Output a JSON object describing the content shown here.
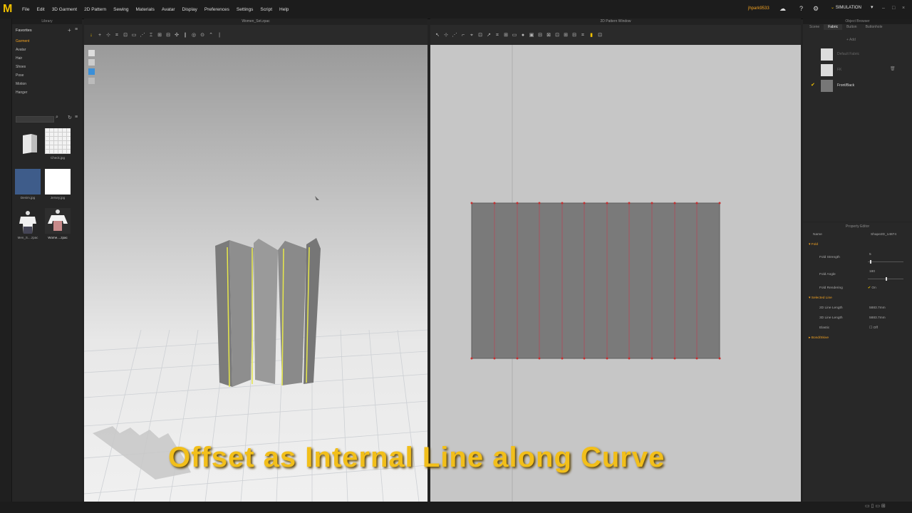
{
  "menubar": {
    "logo": "M",
    "items": [
      "File",
      "Edit",
      "3D Garment",
      "2D Pattern",
      "Sewing",
      "Materials",
      "Avatar",
      "Display",
      "Preferences",
      "Settings",
      "Script",
      "Help"
    ],
    "user": "jhpark9533",
    "mode": "SIMULATION"
  },
  "library": {
    "title": "Library",
    "favorites_label": "Favorites",
    "favorites": [
      "Garment",
      "Avatar",
      "Hair",
      "Shoes",
      "Pose",
      "Motion",
      "Hanger"
    ],
    "thumbs": [
      {
        "label": "",
        "icon": "folder-icon"
      },
      {
        "label": "Check.jpg",
        "icon": "check-fabric-thumb"
      },
      {
        "label": "Denim.jpg",
        "icon": "denim-fabric-thumb"
      },
      {
        "label": "Jersey.jpg",
        "icon": "jersey-fabric-thumb"
      },
      {
        "label": "Men_S....zpac",
        "icon": "men-avatar-thumb"
      },
      {
        "label": "Wome....zpac",
        "icon": "women-avatar-thumb"
      }
    ]
  },
  "viewport3d": {
    "title": "Women_Set.zpac"
  },
  "viewport2d": {
    "title": "2D Pattern Window"
  },
  "object_browser": {
    "title": "Object Browser",
    "tabs": [
      "Scene",
      "Fabric",
      "Button",
      "Buttonhole"
    ],
    "active_tab": "Fabric",
    "add_label": "+ Add",
    "fabrics": [
      {
        "name": "Default Fabric",
        "checked": false
      },
      {
        "name": "FK",
        "checked": false
      },
      {
        "name": "Front/Back",
        "checked": true
      }
    ]
  },
  "property_editor": {
    "title": "Property Editor",
    "name_label": "Name",
    "name_value": "Shape2D_14874",
    "fold_section": "Fold",
    "fold_strength_label": "Fold Strength",
    "fold_strength_value": "5",
    "fold_angle_label": "Fold Angle",
    "fold_angle_value": "180",
    "fold_rendering_label": "Fold Rendering",
    "fold_rendering_value": "On",
    "selected_line_section": "Selected Line",
    "line2d_label": "2D Line Length",
    "line2d_value": "5883.7mm",
    "line3d_label": "3D Line Length",
    "line3d_value": "5883.7mm",
    "elastic_label": "Elastic",
    "elastic_value": "Off",
    "bond_section": "Bond/Skive"
  },
  "caption": "Offset as Internal Line along Curve",
  "colors": {
    "accent": "#f2bf1a",
    "sel_line": "#e7e84a",
    "pattern": "#7a7a7a",
    "seam_point": "#c43030"
  }
}
